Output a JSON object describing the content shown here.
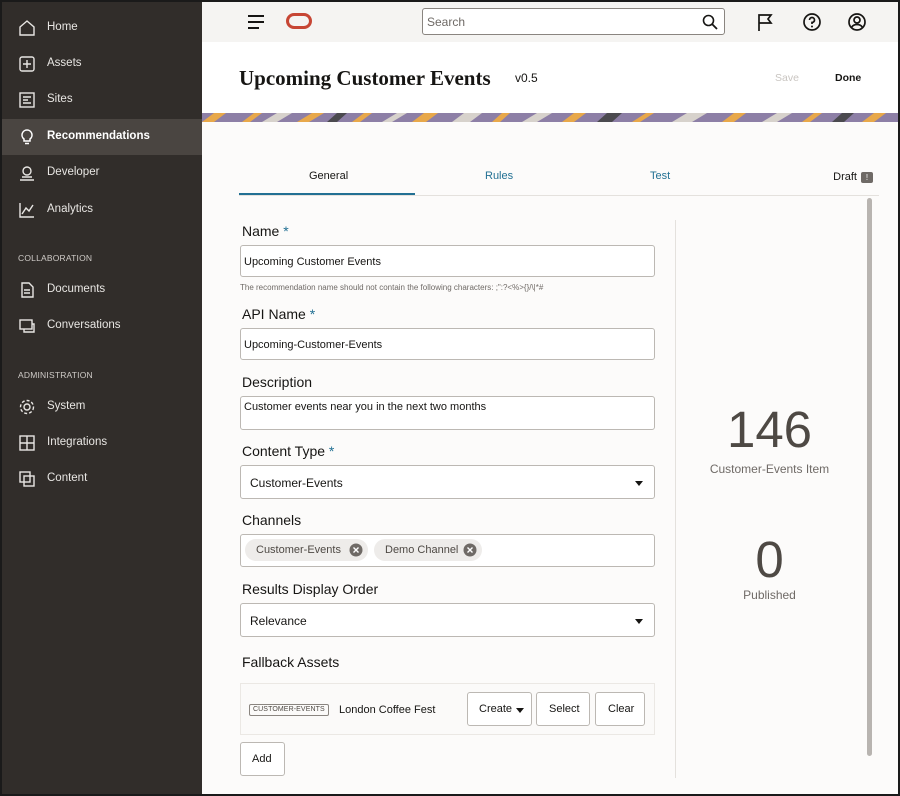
{
  "sidebar": {
    "items": [
      {
        "label": "Home",
        "icon": "home-icon"
      },
      {
        "label": "Assets",
        "icon": "assets-icon"
      },
      {
        "label": "Sites",
        "icon": "sites-icon"
      },
      {
        "label": "Recommendations",
        "icon": "lightbulb-icon",
        "active": true
      },
      {
        "label": "Developer",
        "icon": "developer-icon"
      },
      {
        "label": "Analytics",
        "icon": "analytics-icon"
      }
    ],
    "sections": {
      "collaboration": "COLLABORATION",
      "administration": "ADMINISTRATION"
    },
    "collaboration_items": [
      {
        "label": "Documents",
        "icon": "documents-icon"
      },
      {
        "label": "Conversations",
        "icon": "conversations-icon"
      }
    ],
    "administration_items": [
      {
        "label": "System",
        "icon": "gear-icon"
      },
      {
        "label": "Integrations",
        "icon": "integrations-icon"
      },
      {
        "label": "Content",
        "icon": "content-icon"
      }
    ]
  },
  "topbar": {
    "search_placeholder": "Search",
    "icons": [
      "menu-icon",
      "oracle-logo",
      "search-icon",
      "flag-icon",
      "help-icon",
      "user-icon"
    ]
  },
  "header": {
    "title": "Upcoming Customer Events",
    "version": "v0.5",
    "save_label": "Save",
    "done_label": "Done"
  },
  "tabs": {
    "general": "General",
    "rules": "Rules",
    "test": "Test",
    "draft_label": "Draft",
    "draft_badge": "!"
  },
  "form": {
    "name_label": "Name",
    "name_value": "Upcoming Customer Events",
    "required_mark": "*",
    "name_hint": "The recommendation name should not contain the following characters: ;\":?<%>{}/\\|*#",
    "api_name_label": "API Name",
    "api_name_value": "Upcoming-Customer-Events",
    "description_label": "Description",
    "description_value": "Customer events near you in the next two months",
    "content_type_label": "Content Type",
    "content_type_value": "Customer-Events",
    "channels_label": "Channels",
    "channels": [
      "Customer-Events",
      "Demo Channel"
    ],
    "results_order_label": "Results Display Order",
    "results_order_value": "Relevance",
    "fallback_label": "Fallback Assets",
    "fallback_asset": {
      "type_tag": "CUSTOMER-EVENTS",
      "name": "London Coffee Fest"
    },
    "create_label": "Create",
    "select_label": "Select",
    "clear_label": "Clear",
    "add_label": "Add"
  },
  "stats": {
    "items_count": "146",
    "items_label": "Customer-Events Item",
    "published_count": "0",
    "published_label": "Published"
  },
  "colors": {
    "sidebar_bg": "#312d2a",
    "accent": "#227093",
    "brand_red": "#c74634"
  }
}
